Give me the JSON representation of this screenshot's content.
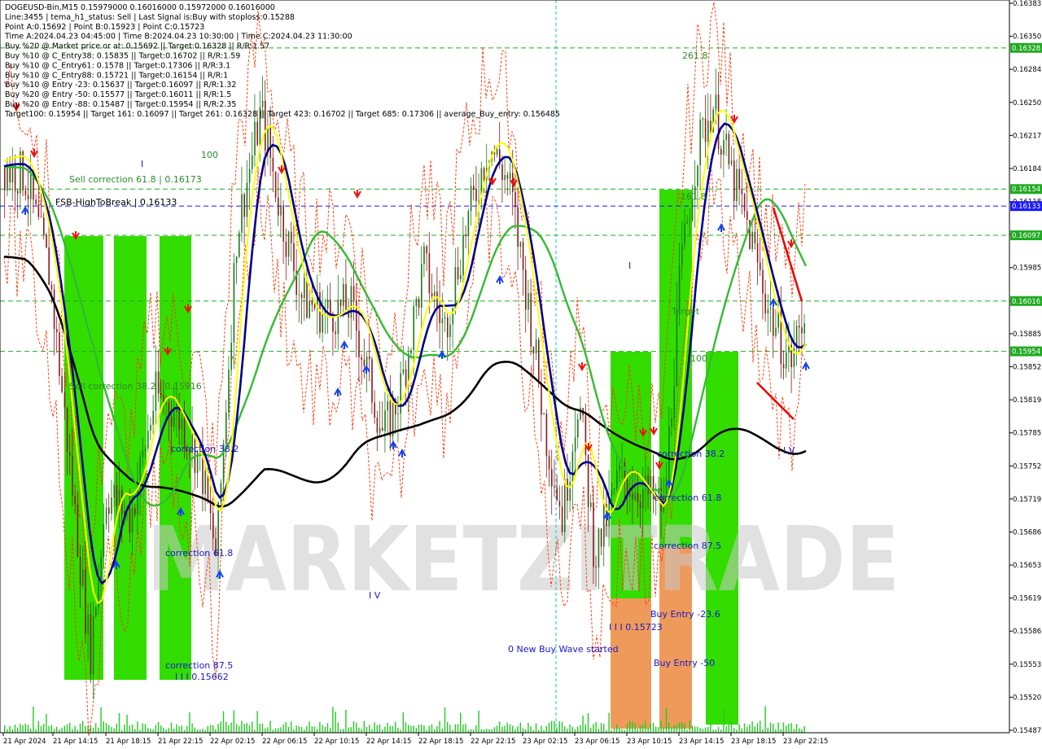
{
  "info_lines": [
    "DOGEUSD-Bin,M15  0.15979000 0.16016000 0.15972000 0.16016000",
    "Line:3455 | tema_h1_status: Sell | Last Signal is:Buy with stoploss:0.15288",
    "Point A:0.15692 | Point B:0.15923 | Point C:0.15723",
    "Time A:2024.04.23 04:45:00 | Time B:2024.04.23 10:30:00 | Time C:2024.04.23 11:30:00",
    "Buy %20 @ Market price or at: 0.15692 || Target:0.16328 || R/R:1.57",
    "Buy %10 @ C_Entry38: 0.15835 || Target:0.16702 || R/R:1.59",
    "Buy %10 @ C_Entry61: 0.1578 || Target:0.17306 || R/R:3.1",
    "Buy %10 @ C_Entry88: 0.15721 || Target:0.16154 || R/R:1",
    "Buy %10 @ Entry -23: 0.15637 || Target:0.16097 || R/R:1.32",
    "Buy %20 @ Entry -50: 0.15577 || Target:0.16011 || R/R:1.5",
    "Buy %20 @ Entry -88: 0.15487 || Target:0.15954 || R/R:2.35",
    "Target100: 0.15954 || Target 161: 0.16097 || Target 261: 0.16328 || Target 423: 0.16702 || Target 685: 0.17306 || average_Buy_entry: 0.156485"
  ],
  "chart_data": {
    "type": "candlestick",
    "symbol": "DOGEUSD-Bin",
    "timeframe": "M15",
    "ylim": [
      0.15487,
      0.16383
    ],
    "y_ticks": [
      "0.16383",
      "0.16350",
      "0.16284",
      "0.16250",
      "0.16217",
      "0.16184",
      "0.16118",
      "0.16051",
      "0.15985",
      "0.15918",
      "0.15885",
      "0.15852",
      "0.15819",
      "0.15785",
      "0.15752",
      "0.15719",
      "0.15686",
      "0.15653",
      "0.15619",
      "0.15586",
      "0.15553",
      "0.15520",
      "0.15487"
    ],
    "x_ticks": [
      "21 Apr 2024",
      "21 Apr 14:15",
      "21 Apr 18:15",
      "21 Apr 22:15",
      "22 Apr 02:15",
      "22 Apr 06:15",
      "22 Apr 10:15",
      "22 Apr 14:15",
      "22 Apr 18:15",
      "22 Apr 22:15",
      "23 Apr 02:15",
      "23 Apr 06:15",
      "23 Apr 10:15",
      "23 Apr 14:15",
      "23 Apr 18:15",
      "23 Apr 22:15"
    ],
    "price_tags": [
      {
        "value": "0.16328",
        "level": 0.16328,
        "color": "#22aa22"
      },
      {
        "value": "0.16154",
        "level": 0.16154,
        "color": "#22aa22"
      },
      {
        "value": "0.16133",
        "level": 0.16133,
        "color": "#1a1aff"
      },
      {
        "value": "0.16097",
        "level": 0.16097,
        "color": "#22aa22"
      },
      {
        "value": "0.16016",
        "level": 0.16016,
        "color": "#22aa22"
      },
      {
        "value": "0.15954",
        "level": 0.15954,
        "color": "#22aa22"
      }
    ],
    "annotations": {
      "level_261": "261.8",
      "level_100_left": "100",
      "level_100_right": "100",
      "sell_correction_618": "Sell correction 61.8 | 0.16173",
      "fsb_high_to_break": "FSB-HighToBreak | 0.16133",
      "sell_correction_382": "Sell correction 38.2 | 0.15916",
      "correction_382_left": "correction 38.2",
      "correction_618_left": "correction 61.8",
      "correction_875_left": "correction 87.5",
      "wave_left": "I I I 0.15662",
      "wave_iv_left": "I V",
      "new_buy_wave": "0 New Buy Wave started",
      "wave_right": "I I I 0.15723",
      "correction_382_right": "correction 38.2",
      "correction_618_right": "correction 61.8",
      "correction_875_right": "correction 87.5",
      "buy_entry_236": "Buy Entry -23.6",
      "buy_entry_50": "Buy Entry -50",
      "wave_iv_right": "I V",
      "wave_i": "I",
      "wave_i_right": "I",
      "target_label": "Target",
      "level_161": "161.8"
    },
    "watermark": "MARKETZITRADE",
    "colors": {
      "zone_green": "#33dd00",
      "zone_orange": "#ef9a5a",
      "ma_black": "#000000",
      "ma_navy": "#00008b",
      "ma_yellow": "#ffff00",
      "ma_green": "#33bb33",
      "up_candle": "#1a7a1a",
      "down_candle": "#8b1a1a",
      "volume": "#22cc22",
      "envelope": "#ff3300"
    }
  }
}
